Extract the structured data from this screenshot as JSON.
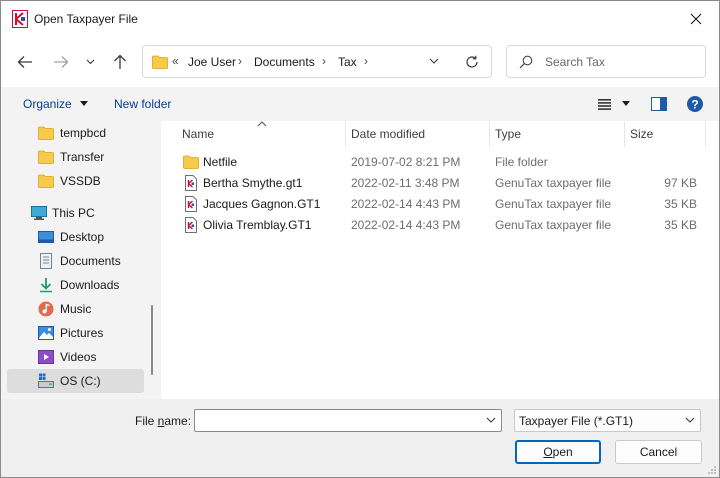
{
  "window": {
    "title": "Open Taxpayer File"
  },
  "address": {
    "overflow": "«",
    "crumbs": [
      "Joe User",
      "Documents",
      "Tax"
    ],
    "chevron": "›"
  },
  "search": {
    "placeholder": "Search Tax"
  },
  "toolbar": {
    "organize": "Organize",
    "new_folder": "New folder"
  },
  "nav": {
    "items": [
      {
        "label": "tempbcd",
        "icon": "folder-icon"
      },
      {
        "label": "Transfer",
        "icon": "folder-icon"
      },
      {
        "label": "VSSDB",
        "icon": "folder-icon"
      },
      {
        "label": "This PC",
        "icon": "computer-icon"
      },
      {
        "label": "Desktop",
        "icon": "desktop-icon"
      },
      {
        "label": "Documents",
        "icon": "documents-icon"
      },
      {
        "label": "Downloads",
        "icon": "downloads-icon"
      },
      {
        "label": "Music",
        "icon": "music-icon"
      },
      {
        "label": "Pictures",
        "icon": "pictures-icon"
      },
      {
        "label": "Videos",
        "icon": "videos-icon"
      },
      {
        "label": "OS (C:)",
        "icon": "drive-icon"
      }
    ],
    "selected": "OS (C:)"
  },
  "columns": {
    "name": "Name",
    "date": "Date modified",
    "type": "Type",
    "size": "Size"
  },
  "files": [
    {
      "name": "Netfile",
      "date": "2019-07-02 8:21 PM",
      "type": "File folder",
      "size": "",
      "icon": "folder-icon"
    },
    {
      "name": "Bertha Smythe.gt1",
      "date": "2022-02-11 3:48 PM",
      "type": "GenuTax taxpayer file",
      "size": "97 KB",
      "icon": "taxfile-icon"
    },
    {
      "name": "Jacques Gagnon.GT1",
      "date": "2022-02-14 4:43 PM",
      "type": "GenuTax taxpayer file",
      "size": "35 KB",
      "icon": "taxfile-icon"
    },
    {
      "name": "Olivia Tremblay.GT1",
      "date": "2022-02-14 4:43 PM",
      "type": "GenuTax taxpayer file",
      "size": "35 KB",
      "icon": "taxfile-icon"
    }
  ],
  "footer": {
    "file_name_label_pre": "File ",
    "file_name_label_key": "n",
    "file_name_label_post": "ame:",
    "file_name_value": "",
    "file_type": "Taxpayer File (*.GT1)",
    "open_key": "O",
    "open_rest": "pen",
    "cancel": "Cancel"
  },
  "colors": {
    "accent": "#0067c0",
    "folder": "#f8c94a",
    "link": "#003e92"
  }
}
